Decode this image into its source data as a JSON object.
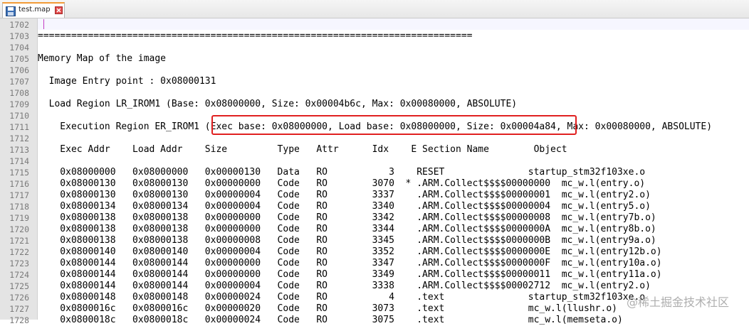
{
  "tab": {
    "filename": "test.map",
    "save_icon": "floppy-disk-icon",
    "close_icon": "close-icon"
  },
  "line_numbers": [
    "1702",
    "1703",
    "1704",
    "1705",
    "1706",
    "1707",
    "1708",
    "1709",
    "1710",
    "1711",
    "1712",
    "1713",
    "1714",
    "1715",
    "1716",
    "1717",
    "1718",
    "1719",
    "1720",
    "1721",
    "1722",
    "1723",
    "1724",
    "1725",
    "1726",
    "1727",
    "1728"
  ],
  "lines": [
    "",
    "==============================================================================",
    "",
    "Memory Map of the image",
    "",
    "  Image Entry point : 0x08000131",
    "",
    "  Load Region LR_IROM1 (Base: 0x08000000, Size: 0x00004b6c, Max: 0x00080000, ABSOLUTE)",
    "",
    "    Execution Region ER_IROM1 (Exec base: 0x08000000, Load base: 0x08000000, Size: 0x00004a84, Max: 0x00080000, ABSOLUTE)",
    "",
    "    Exec Addr    Load Addr    Size         Type   Attr      Idx    E Section Name        Object",
    "",
    "    0x08000000   0x08000000   0x00000130   Data   RO           3    RESET               startup_stm32f103xe.o",
    "    0x08000130   0x08000130   0x00000000   Code   RO        3070  * .ARM.Collect$$$$00000000  mc_w.l(entry.o)",
    "    0x08000130   0x08000130   0x00000004   Code   RO        3337    .ARM.Collect$$$$00000001  mc_w.l(entry2.o)",
    "    0x08000134   0x08000134   0x00000004   Code   RO        3340    .ARM.Collect$$$$00000004  mc_w.l(entry5.o)",
    "    0x08000138   0x08000138   0x00000000   Code   RO        3342    .ARM.Collect$$$$00000008  mc_w.l(entry7b.o)",
    "    0x08000138   0x08000138   0x00000000   Code   RO        3344    .ARM.Collect$$$$0000000A  mc_w.l(entry8b.o)",
    "    0x08000138   0x08000138   0x00000008   Code   RO        3345    .ARM.Collect$$$$0000000B  mc_w.l(entry9a.o)",
    "    0x08000140   0x08000140   0x00000004   Code   RO        3352    .ARM.Collect$$$$0000000E  mc_w.l(entry12b.o)",
    "    0x08000144   0x08000144   0x00000000   Code   RO        3347    .ARM.Collect$$$$0000000F  mc_w.l(entry10a.o)",
    "    0x08000144   0x08000144   0x00000000   Code   RO        3349    .ARM.Collect$$$$00000011  mc_w.l(entry11a.o)",
    "    0x08000144   0x08000144   0x00000004   Code   RO        3338    .ARM.Collect$$$$00002712  mc_w.l(entry2.o)",
    "    0x08000148   0x08000148   0x00000024   Code   RO           4    .text               startup_stm32f103xe.o",
    "    0x0800016c   0x0800016c   0x00000020   Code   RO        3073    .text               mc_w.l(llushr.o)",
    "    0x0800018c   0x0800018c   0x00000024   Code   RO        3075    .text               mc_w.l(memseta.o)"
  ],
  "watermark": "@稀土掘金技术社区",
  "colors": {
    "highlight_border": "#e02020",
    "tab_accent": "#f29b37",
    "caret": "#c43ec4"
  }
}
